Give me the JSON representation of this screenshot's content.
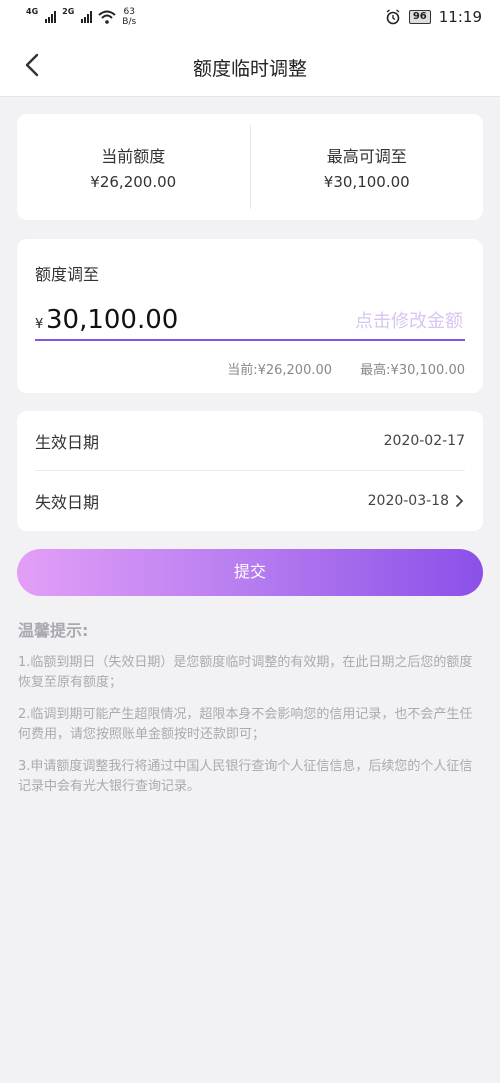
{
  "status_bar": {
    "signal1": "4G",
    "signal2": "2G",
    "speed_value": "63",
    "speed_unit": "B/s",
    "battery": "96",
    "time": "11:19"
  },
  "nav": {
    "title": "额度临时调整"
  },
  "summary": {
    "current_label": "当前额度",
    "current_value": "¥26,200.00",
    "max_label": "最高可调至",
    "max_value": "¥30,100.00"
  },
  "adjust": {
    "label": "额度调至",
    "currency": "¥",
    "amount": "30,100.00",
    "hint": "点击修改金额",
    "current_note": "当前:¥26,200.00",
    "max_note": "最高:¥30,100.00"
  },
  "dates": {
    "effective_label": "生效日期",
    "effective_value": "2020-02-17",
    "expiry_label": "失效日期",
    "expiry_value": "2020-03-18"
  },
  "submit_label": "提交",
  "tips": {
    "title": "温馨提示:",
    "items": [
      "1.临额到期日（失效日期）是您额度临时调整的有效期，在此日期之后您的额度恢复至原有额度；",
      "2.临调到期可能产生超限情况，超限本身不会影响您的信用记录，也不会产生任何费用，请您按照账单金额按时还款即可；",
      "3.申请额度调整我行将通过中国人民银行查询个人征信信息，后续您的个人征信记录中会有光大银行查询记录。"
    ]
  },
  "colors": {
    "accent": "#8a52e0",
    "gradient_start": "#e39ff7",
    "gradient_end": "#8b50e8",
    "background": "#f2f2f5"
  }
}
